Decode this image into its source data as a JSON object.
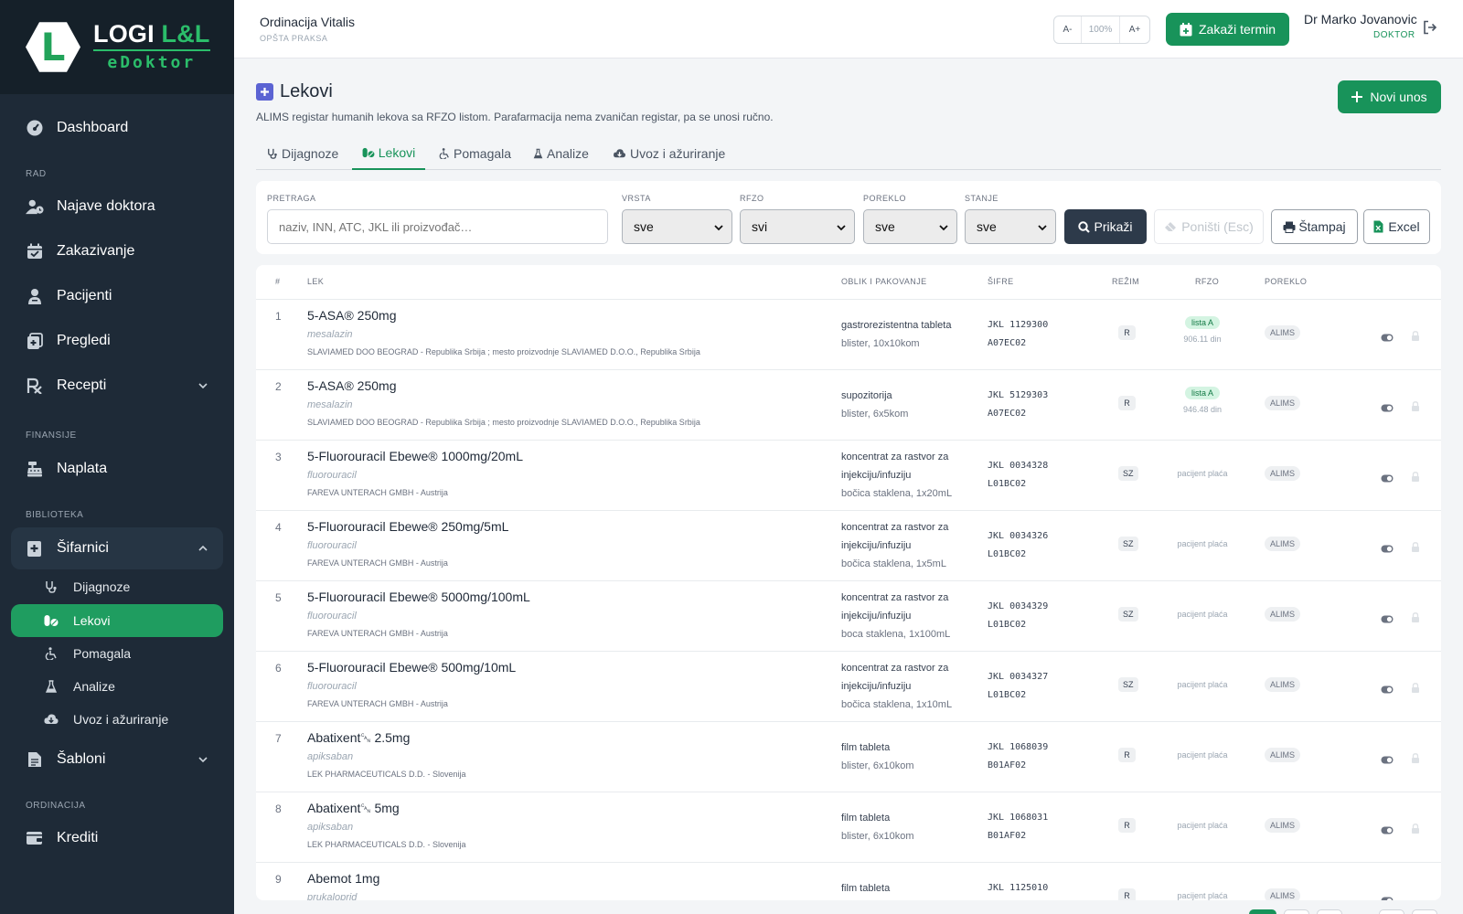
{
  "logo": {
    "brand_white": "LOGI",
    "brand_green": "L&L",
    "sub": "eDoktor",
    "letter": "L"
  },
  "sidebar": {
    "dashboard": "Dashboard",
    "section_rad": "RAD",
    "najave": "Najave doktora",
    "zakazivanje": "Zakazivanje",
    "pacijenti": "Pacijenti",
    "pregledi": "Pregledi",
    "recepti": "Recepti",
    "section_finansije": "FINANSIJE",
    "naplata": "Naplata",
    "section_biblioteka": "BIBLIOTEKA",
    "sifarnici": "Šifarnici",
    "sub": [
      "Dijagnoze",
      "Lekovi",
      "Pomagala",
      "Analize",
      "Uvoz i ažuriranje"
    ],
    "sabloni": "Šabloni",
    "section_ordinacija": "ORDINACIJA",
    "krediti": "Krediti"
  },
  "topbar": {
    "clinic_name": "Ordinacija Vitalis",
    "clinic_sub": "OPŠTA PRAKSA",
    "zoom_minus": "A-",
    "zoom_value": "100%",
    "zoom_plus": "A+",
    "schedule_button": "Zakaži termin",
    "user_name": "Dr Marko Jovanovic",
    "user_role": "DOKTOR"
  },
  "page": {
    "title": "Lekovi",
    "description": "ALIMS registar humanih lekova sa RFZO listom. Parafarmacija nema zvaničan registar, pa se unosi ručno.",
    "new_button": "Novi unos"
  },
  "tabs": [
    "Dijagnoze",
    "Lekovi",
    "Pomagala",
    "Analize",
    "Uvoz i ažuriranje"
  ],
  "filters": {
    "search_label": "PRETRAGA",
    "search_placeholder": "naziv, INN, ATC, JKL ili proizvođač…",
    "vrsta_label": "VRSTA",
    "vrsta_value": "sve",
    "rfzo_label": "RFZO",
    "rfzo_value": "svi",
    "poreklo_label": "POREKLO",
    "poreklo_value": "sve",
    "stanje_label": "STANJE",
    "stanje_value": "sve",
    "show_button": "Prikaži",
    "reset_button": "Poništi (Esc)",
    "print_button": "Štampaj",
    "excel_button": "Excel"
  },
  "table": {
    "headers": {
      "num": "#",
      "lek": "LEK",
      "oblik": "OBLIK I PAKOVANJE",
      "sifre": "ŠIFRE",
      "rezim": "REŽIM",
      "rfzo": "RFZO",
      "poreklo": "POREKLO"
    },
    "rows": [
      {
        "num": "1",
        "name": "5-ASA® 250mg",
        "inn": "mesalazin",
        "mfr": "SLAVIAMED DOO BEOGRAD - Republika Srbija ; mesto proizvodnje SLAVIAMED D.O.O., Republika Srbija",
        "form": "gastrorezistentna tableta",
        "pack": "blister, 10x10kom",
        "jkl": "JKL 1129300",
        "atc": "A07EC02",
        "rezim": "R",
        "rfzo_list": "lista A",
        "rfzo_price": "906.11 din",
        "origin": "ALIMS"
      },
      {
        "num": "2",
        "name": "5-ASA® 250mg",
        "inn": "mesalazin",
        "mfr": "SLAVIAMED DOO BEOGRAD - Republika Srbija ; mesto proizvodnje SLAVIAMED D.O.O., Republika Srbija",
        "form": "supozitorija",
        "pack": "blister, 6x5kom",
        "jkl": "JKL 5129303",
        "atc": "A07EC02",
        "rezim": "R",
        "rfzo_list": "lista A",
        "rfzo_price": "946.48 din",
        "origin": "ALIMS"
      },
      {
        "num": "3",
        "name": "5-Fluorouracil Ebewe® 1000mg/20mL",
        "inn": "fluorouracil",
        "mfr": "FAREVA UNTERACH GMBH - Austrija",
        "form": "koncentrat za rastvor za injekciju/infuziju",
        "pack": "bočica staklena, 1x20mL",
        "jkl": "JKL 0034328",
        "atc": "L01BC02",
        "rezim": "SZ",
        "rfzo_text": "pacijent plaća",
        "origin": "ALIMS"
      },
      {
        "num": "4",
        "name": "5-Fluorouracil Ebewe® 250mg/5mL",
        "inn": "fluorouracil",
        "mfr": "FAREVA UNTERACH GMBH - Austrija",
        "form": "koncentrat za rastvor za injekciju/infuziju",
        "pack": "bočica staklena, 1x5mL",
        "jkl": "JKL 0034326",
        "atc": "L01BC02",
        "rezim": "SZ",
        "rfzo_text": "pacijent plaća",
        "origin": "ALIMS"
      },
      {
        "num": "5",
        "name": "5-Fluorouracil Ebewe® 5000mg/100mL",
        "inn": "fluorouracil",
        "mfr": "FAREVA UNTERACH GMBH - Austrija",
        "form": "koncentrat za rastvor za injekciju/infuziju",
        "pack": "boca staklena, 1x100mL",
        "jkl": "JKL 0034329",
        "atc": "L01BC02",
        "rezim": "SZ",
        "rfzo_text": "pacijent plaća",
        "origin": "ALIMS"
      },
      {
        "num": "6",
        "name": "5-Fluorouracil Ebewe® 500mg/10mL",
        "inn": "fluorouracil",
        "mfr": "FAREVA UNTERACH GMBH - Austrija",
        "form": "koncentrat za rastvor za injekciju/infuziju",
        "pack": "bočica staklena, 1x10mL",
        "jkl": "JKL 0034327",
        "atc": "L01BC02",
        "rezim": "SZ",
        "rfzo_text": "pacijent plaća",
        "origin": "ALIMS"
      },
      {
        "num": "7",
        "name": "Abatixent␘ 2.5mg",
        "inn": "apiksaban",
        "mfr": "LEK PHARMACEUTICALS D.D. - Slovenija",
        "form": "film tableta",
        "pack": "blister, 6x10kom",
        "jkl": "JKL 1068039",
        "atc": "B01AF02",
        "rezim": "R",
        "rfzo_text": "pacijent plaća",
        "origin": "ALIMS"
      },
      {
        "num": "8",
        "name": "Abatixent␘ 5mg",
        "inn": "apiksaban",
        "mfr": "LEK PHARMACEUTICALS D.D. - Slovenija",
        "form": "film tableta",
        "pack": "blister, 6x10kom",
        "jkl": "JKL 1068031",
        "atc": "B01AF02",
        "rezim": "R",
        "rfzo_text": "pacijent plaća",
        "origin": "ALIMS"
      },
      {
        "num": "9",
        "name": "Abemot 1mg",
        "inn": "prukaloprid",
        "mfr": "",
        "form": "film tableta",
        "pack": "",
        "jkl": "JKL 1125010",
        "atc": "",
        "rezim": "R",
        "rfzo_text": "pacijent plaća",
        "origin": "ALIMS"
      }
    ]
  },
  "colors": {
    "brand_green": "#18935a",
    "sidebar_bg": "#1e2a37",
    "logo_bg": "#152029"
  }
}
